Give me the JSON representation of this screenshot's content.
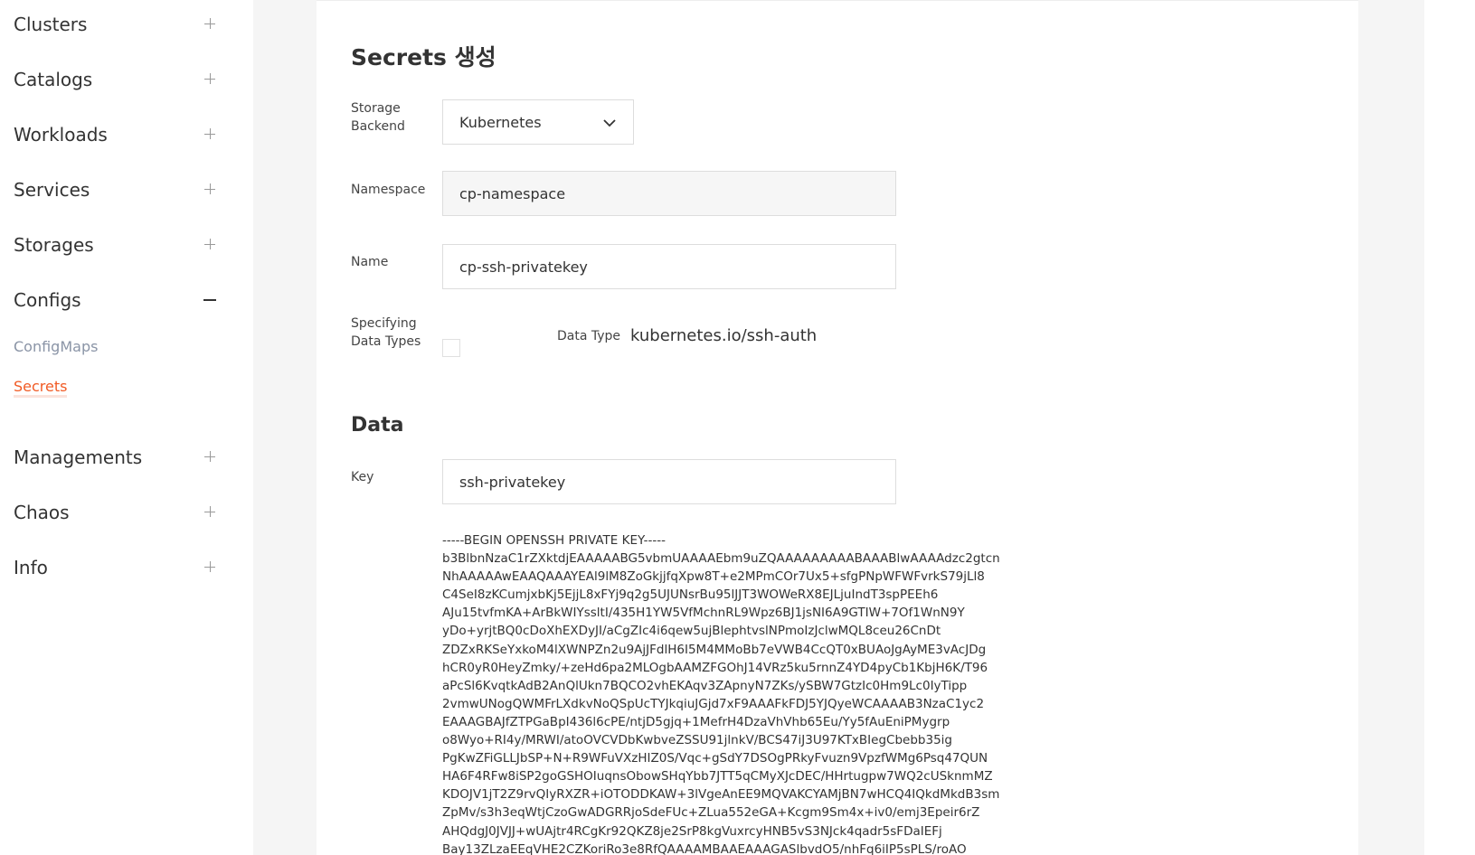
{
  "sidebar": {
    "items": [
      {
        "label": "Clusters",
        "toggle": "plus"
      },
      {
        "label": "Catalogs",
        "toggle": "plus"
      },
      {
        "label": "Workloads",
        "toggle": "plus"
      },
      {
        "label": "Services",
        "toggle": "plus"
      },
      {
        "label": "Storages",
        "toggle": "plus"
      },
      {
        "label": "Configs",
        "toggle": "minus"
      },
      {
        "label": "Managements",
        "toggle": "plus"
      },
      {
        "label": "Chaos",
        "toggle": "plus"
      },
      {
        "label": "Info",
        "toggle": "plus"
      }
    ],
    "config_subitems": [
      {
        "label": "ConfigMaps",
        "active": false
      },
      {
        "label": "Secrets",
        "active": true
      }
    ]
  },
  "form": {
    "title": "Secrets 생성",
    "storage_backend": {
      "label_line1": "Storage",
      "label_line2": "Backend",
      "value": "Kubernetes"
    },
    "namespace": {
      "label": "Namespace",
      "value": "cp-namespace"
    },
    "name": {
      "label": "Name",
      "value": "cp-ssh-privatekey"
    },
    "specifying": {
      "label_line1": "Specifying",
      "label_line2": "Data Types",
      "checked": false
    },
    "data_type": {
      "label": "Data Type",
      "value": "kubernetes.io/ssh-auth"
    }
  },
  "data_section": {
    "title": "Data",
    "key": {
      "label": "Key",
      "value": "ssh-privatekey"
    },
    "value_text": "-----BEGIN OPENSSH PRIVATE KEY-----\nb3BlbnNzaC1rZXktdjEAAAAABG5vbmUAAAAEbm9uZQAAAAAAAAABAAABlwAAAAdzc2gtcn\nNhAAAAAwEAAQAAAYEAl9lM8ZoGkjjfqXpw8T+e2MPmCOr7Ux5+sfgPNpWFWFvrkS79jLl8\nC4SeI8zKCumjxbKj5EjjL8xFYj9q2g5UJUNsrBu95lJJT3WOWeRX8EJLjuIndT3spPEEh6\nAJu15tvfmKA+ArBkWIYssltI/435H1YW5VfMchnRL9Wpz6BJ1jsNI6A9GTIW+7Of1WnN9Y\nyDo+yrjtBQ0cDoXhEXDyJI/aCgZIc4i6qew5ujBlephtvslNPmoIzJclwMQL8ceu26CnDt\nZDZxRKSeYxkoM4lXWNPZn2u9AjJFdlH6I5M4MMoBb7eVWB4CcQT0xBUAoJgAyME3vAcJDg\nhCR0yR0HeyZmky/+zeHd6pa2MLOgbAAMZFGOhJ14VRz5ku5rnnZ4YD4pyCb1KbjH6K/T96\naPcSl6KvqtkAdB2AnQlUkn7BQCO2vhEKAqv3ZApnyN7ZKs/ySBW7GtzIc0Hm9Lc0IyTipp\n2vmwUNogQWMFrLXdkvNoQSpUcTYJkqiuJGjd7xF9AAAFkFDJ5YJQyeWCAAAAB3NzaC1yc2\nEAAAGBAJfZTPGaBpI436l6cPE/ntjD5gjq+1MefrH4DzaVhVhb65Eu/Yy5fAuEniPMygrp\no8Wyo+RI4y/MRWI/atoOVCVDbKwbveZSSU91jlnkV/BCS47iJ3U97KTxBIegCbebb35ig\nPgKwZFiGLLJbSP+N+R9WFuVXzHIZ0S/Vqc+gSdY7DSOgPRkyFvuzn9VpzfWMg6Psq47QUN\nHA6F4RFw8iSP2goGSHOIuqnsObowSHqYbb7JTT5qCMyXJcDEC/HHrtugpw7WQ2cUSknmMZ\nKDOJV1jT2Z9rvQIyRXZR+iOTODDKAW+3lVgeAnEE9MQVAKCYAMjBN7wHCQ4IQkdMkdB3sm\nZpMv/s3h3eqWtjCzoGwADGRRjoSdeFUc+ZLua552eGA+Kcgm9Sm4x+iv0/emj3Epeir6rZ\nAHQdgJ0JVJJ+wUAjtr4RCgKr92QKZ8je2SrP8kgVuxrcyHNB5vS3NJck4qadr5sFDaIEFj\nBay13ZLzaEEqVHE2CZKoriRo3e8RfQAAAAMBAAEAAAGASlbvdO5/nhFq6iIP5sPLS/roAO"
  },
  "colors": {
    "accent": "#f15a24",
    "sub_inactive": "#8a94a6",
    "page_bg": "#f5f5f5"
  }
}
